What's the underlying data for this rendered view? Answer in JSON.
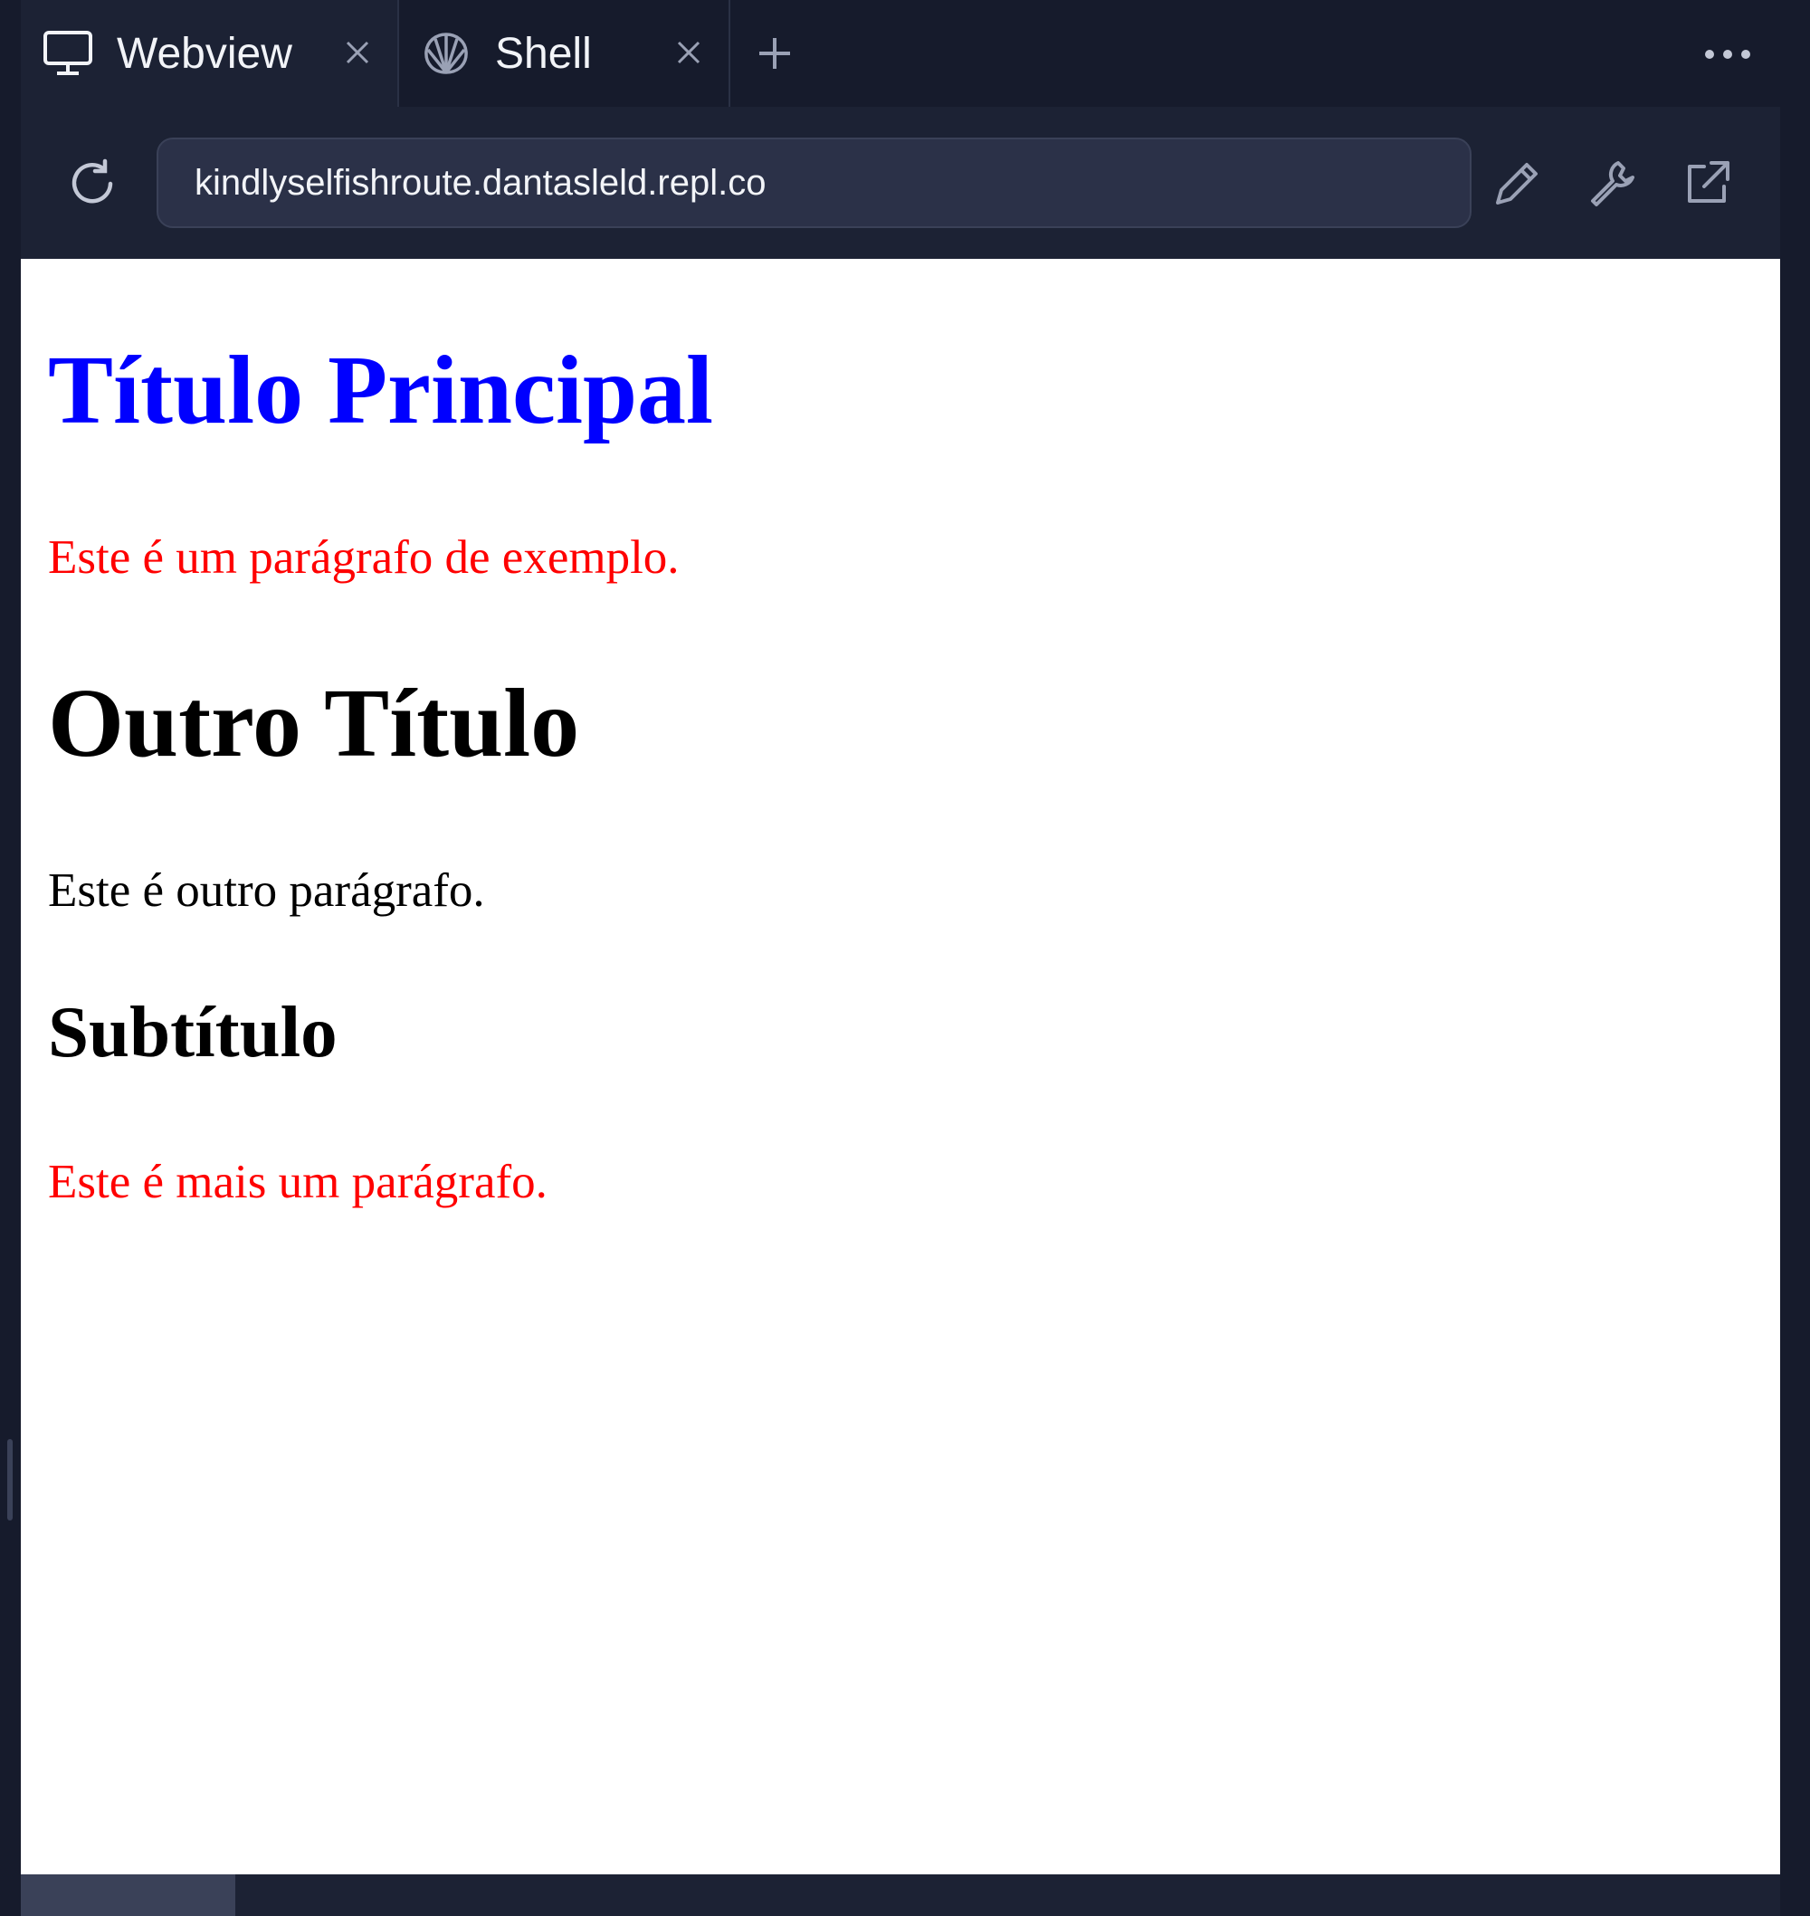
{
  "tabs": [
    {
      "label": "Webview",
      "icon": "monitor-icon",
      "active": true
    },
    {
      "label": "Shell",
      "icon": "shell-icon",
      "active": false
    }
  ],
  "toolbar": {
    "url": "kindlyselfishroute.dantasleld.repl.co"
  },
  "page": {
    "main_title": "Título Principal",
    "paragraph_1": "Este é um parágrafo de exemplo.",
    "second_title": "Outro Título",
    "paragraph_2": "Este é outro parágrafo.",
    "subtitle": "Subtítulo",
    "paragraph_3": "Este é mais um parágrafo."
  },
  "colors": {
    "main_title": "#0000ff",
    "red_paragraphs": "#ff0000",
    "chrome_bg": "#161b2c",
    "toolbar_bg": "#1c2234",
    "urlbar_bg": "#2b3148"
  }
}
